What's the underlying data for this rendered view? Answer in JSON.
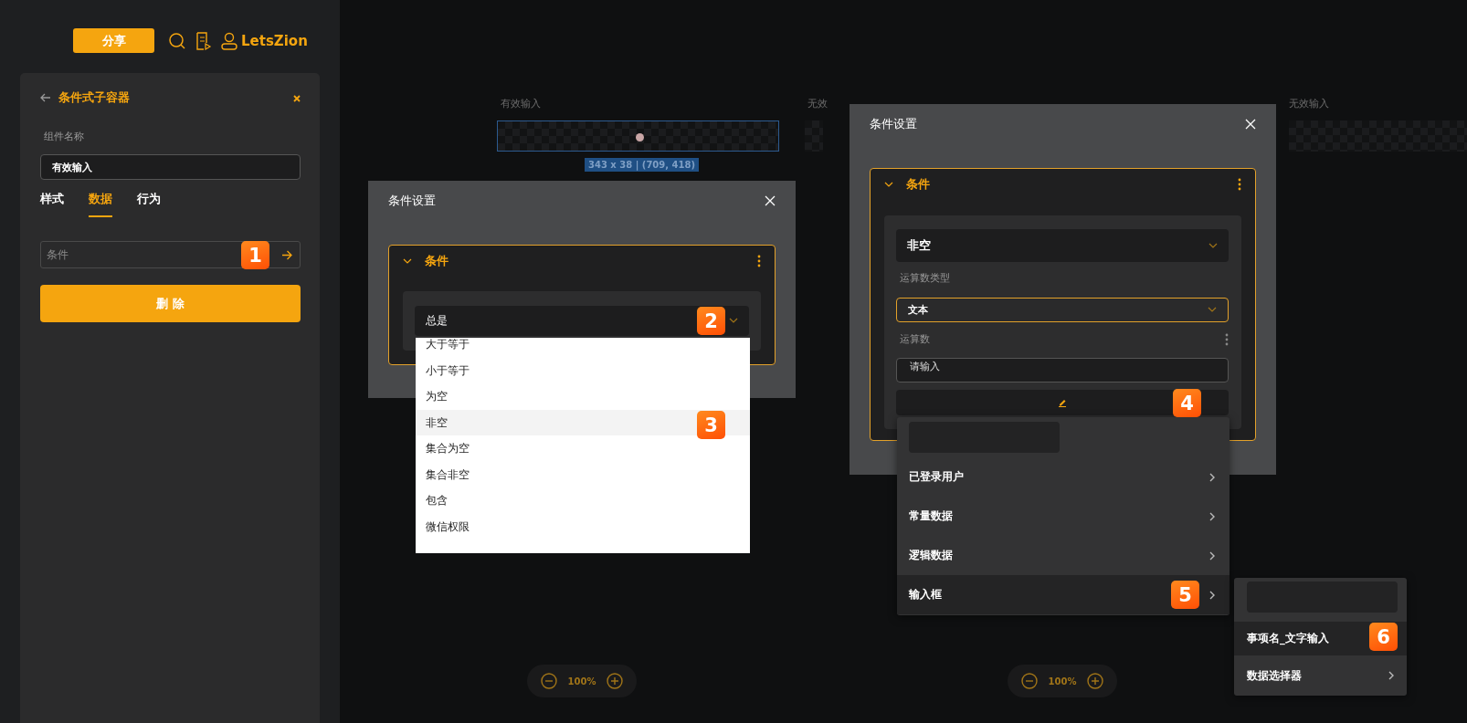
{
  "header": {
    "share_button": "分享",
    "user": "LetsZion"
  },
  "panel": {
    "title": "条件式子容器",
    "name_label": "组件名称",
    "name_value": "有效输入",
    "tabs": [
      {
        "label": "样式",
        "selected": false
      },
      {
        "label": "数据",
        "selected": true
      },
      {
        "label": "行为",
        "selected": false
      }
    ],
    "condition_field": "条件",
    "delete_button": "删 除"
  },
  "canvas": {
    "labels": [
      "有效输入",
      "无效",
      "无效输入"
    ],
    "selection_size": "343 x 38 | (709, 418)",
    "zoom_controls": [
      "100%",
      "100%"
    ]
  },
  "dialogs": [
    {
      "title": "条件设置",
      "condition_title": "条件",
      "operator": "总是",
      "dropdown": [
        {
          "label": "大于等于",
          "selected": false
        },
        {
          "label": "小于等于",
          "selected": false
        },
        {
          "label": "为空",
          "selected": false
        },
        {
          "label": "非空",
          "selected": true
        },
        {
          "label": "集合为空",
          "selected": false
        },
        {
          "label": "集合非空",
          "selected": false
        },
        {
          "label": "包含",
          "selected": false
        },
        {
          "label": "微信权限",
          "selected": false
        }
      ]
    },
    {
      "title": "条件设置",
      "condition_title": "条件",
      "operator": "非空",
      "operand_type_label": "运算数类型",
      "operand_type": "文本",
      "operand_label": "运算数",
      "operand_placeholder": "请输入"
    }
  ],
  "menus": [
    {
      "items": [
        {
          "label": "已登录用户",
          "submenu": true,
          "selected": false
        },
        {
          "label": "常量数据",
          "submenu": true,
          "selected": false
        },
        {
          "label": "逻辑数据",
          "submenu": true,
          "selected": false
        },
        {
          "label": "输入框",
          "submenu": true,
          "selected": true
        }
      ]
    },
    {
      "items": [
        {
          "label": "事项名_文字输入",
          "submenu": false,
          "selected": true
        },
        {
          "label": "数据选择器",
          "submenu": true,
          "selected": false
        }
      ]
    }
  ],
  "markers": [
    "1",
    "2",
    "3",
    "4",
    "5",
    "6"
  ]
}
